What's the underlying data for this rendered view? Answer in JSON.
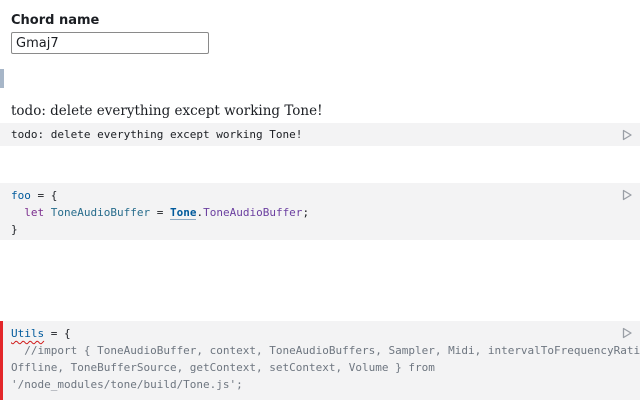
{
  "form": {
    "label": "Chord name",
    "value": "Gmaj7",
    "placeholder": ""
  },
  "output_text": "todo: delete everything except working Tone!",
  "cells": {
    "todo": {
      "line1": "todo: delete everything except working Tone!"
    },
    "foo": {
      "name": "foo",
      "assign": " = {",
      "indent": "  ",
      "let": "let",
      "var_name": "ToneAudioBuffer",
      "eq": " = ",
      "obj": "Tone",
      "dot": ".",
      "member": "ToneAudioBuffer",
      "semi": ";",
      "close": "}"
    },
    "utils": {
      "name": "Utils",
      "assign": " = {",
      "comment_1": "  //import { ToneAudioBuffer, context, ToneAudioBuffers, Sampler, Midi, intervalToFrequencyRatio,",
      "comment_2": "Offline, ToneBufferSource, getContext, setContext, Volume } from",
      "comment_3": "'/node_modules/tone/build/Tone.js';"
    }
  },
  "icons": {
    "run": "play-icon"
  },
  "colors": {
    "cell_bg": "#f3f3f4",
    "error_marker": "#e3262a",
    "focus_marker": "#a7b6c8"
  }
}
